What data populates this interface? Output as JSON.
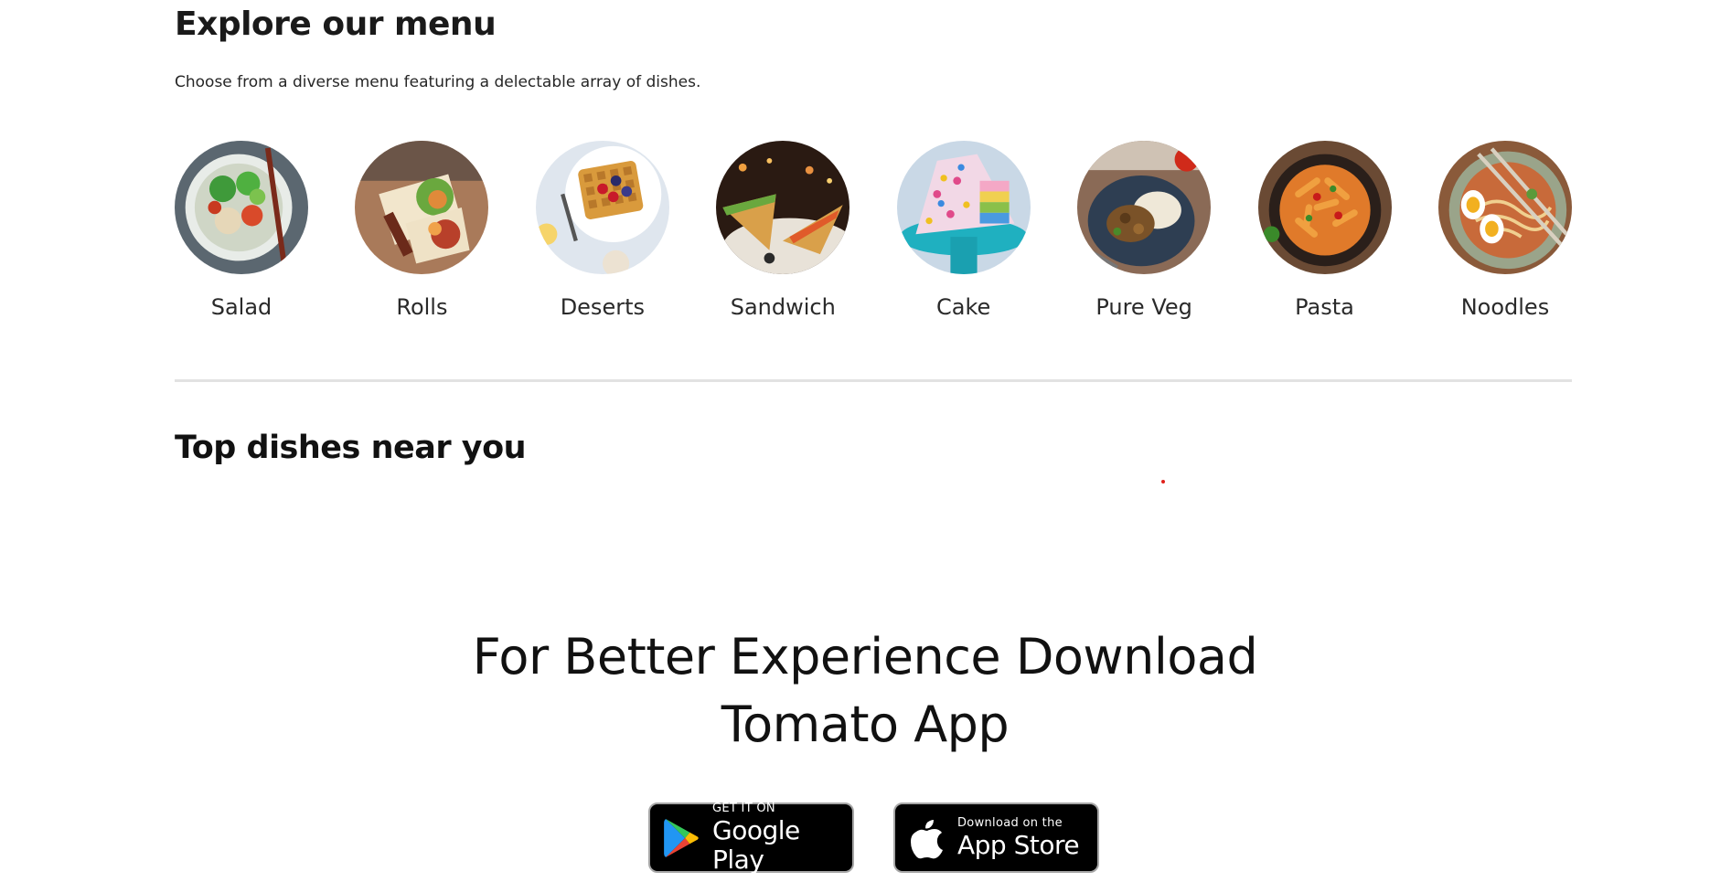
{
  "explore": {
    "title": "Explore our menu",
    "subtitle": "Choose from a diverse menu featuring a delectable array of dishes.",
    "items": [
      {
        "label": "Salad",
        "icon": "salad-image"
      },
      {
        "label": "Rolls",
        "icon": "rolls-image"
      },
      {
        "label": "Deserts",
        "icon": "deserts-image"
      },
      {
        "label": "Sandwich",
        "icon": "sandwich-image"
      },
      {
        "label": "Cake",
        "icon": "cake-image"
      },
      {
        "label": "Pure Veg",
        "icon": "pure-veg-image"
      },
      {
        "label": "Pasta",
        "icon": "pasta-image"
      },
      {
        "label": "Noodles",
        "icon": "noodles-image"
      }
    ]
  },
  "top_dishes": {
    "title": "Top dishes near you"
  },
  "app_download": {
    "title_line1": "For Better Experience Download",
    "title_line2": "Tomato App",
    "google_play": {
      "small": "GET IT ON",
      "big": "Google Play",
      "icon": "google-play-icon"
    },
    "app_store": {
      "small": "Download on the",
      "big": "App Store",
      "icon": "apple-icon"
    }
  },
  "colors": {
    "accent": "#e0201a",
    "badge_bg": "#000000",
    "divider": "#e2e2e2"
  }
}
